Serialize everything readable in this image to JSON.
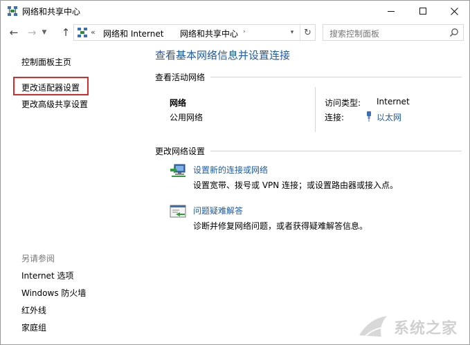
{
  "window": {
    "title": "网络和共享中心"
  },
  "address": {
    "chevrons": "«",
    "segments": [
      "网络和 Internet",
      "网络和共享中心"
    ]
  },
  "search": {
    "placeholder": "搜索控制面板"
  },
  "sidebar": {
    "items": [
      {
        "label": "控制面板主页"
      },
      {
        "label": "更改适配器设置"
      },
      {
        "label": "更改高级共享设置"
      }
    ],
    "see_also_heading": "另请参阅",
    "see_also": [
      {
        "label": "Internet 选项"
      },
      {
        "label": "Windows 防火墙"
      },
      {
        "label": "红外线"
      },
      {
        "label": "家庭组"
      }
    ]
  },
  "main": {
    "title": "查看基本网络信息并设置连接",
    "active_networks_heading": "查看活动网络",
    "network": {
      "name": "网络",
      "category": "公用网络",
      "access_type_label": "访问类型:",
      "access_type_value": "Internet",
      "connection_label": "连接:",
      "connection_value": "以太网"
    },
    "change_settings_heading": "更改网络设置",
    "tasks": [
      {
        "link": "设置新的连接或网络",
        "description": "设置宽带、拨号或 VPN 连接；或设置路由器或接入点。"
      },
      {
        "link": "问题疑难解答",
        "description": "诊断并修复网络问题，或者获得疑难解答信息。"
      }
    ]
  },
  "watermark": {
    "text": "系统之家"
  },
  "colors": {
    "link": "#1e5aa8",
    "highlight": "#d62b2b"
  }
}
